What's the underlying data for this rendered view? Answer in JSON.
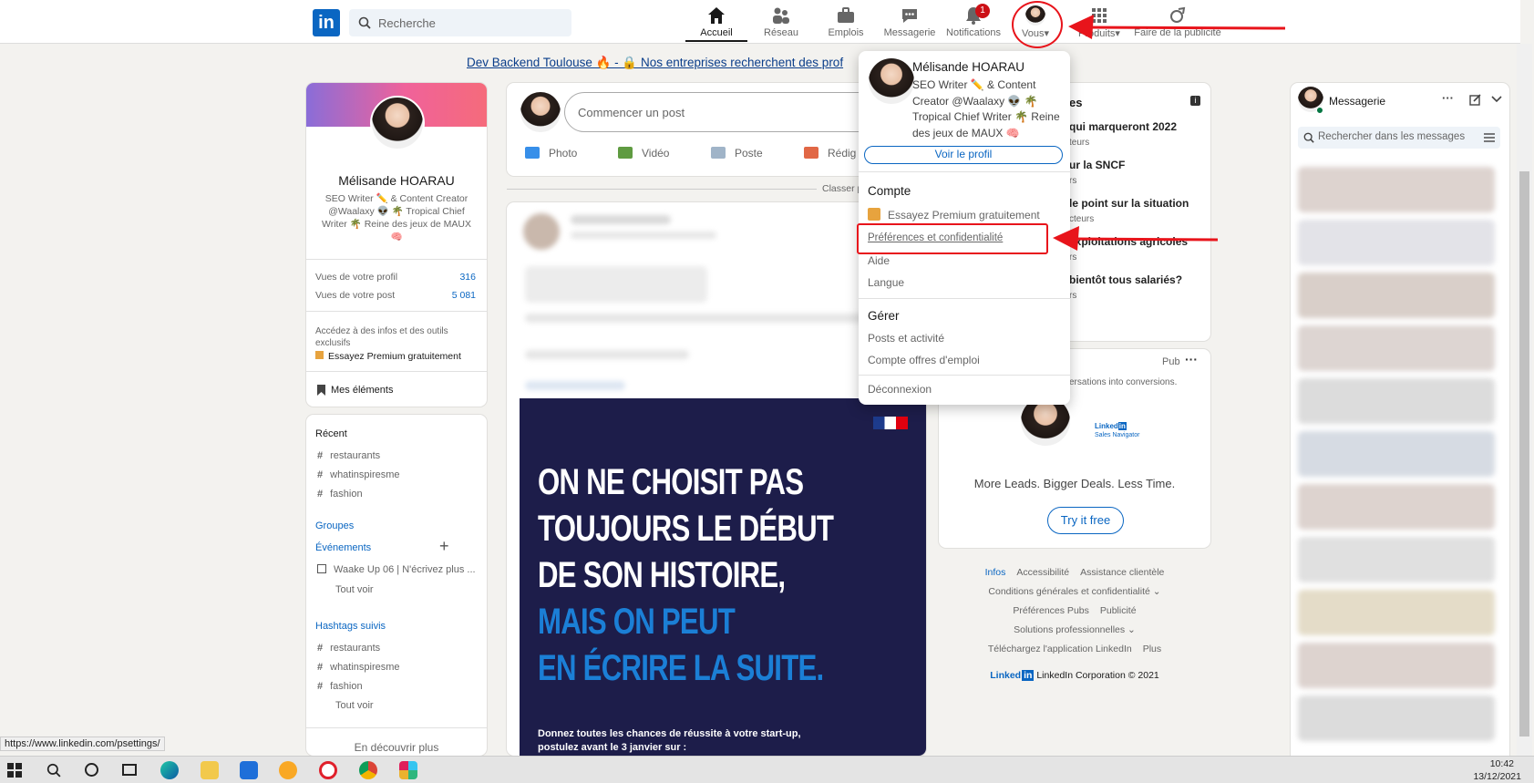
{
  "nav": {
    "search_placeholder": "Recherche",
    "items": [
      "Accueil",
      "Réseau",
      "Emplois",
      "Messagerie",
      "Notifications",
      "Vous",
      "Produits",
      "Faire de la publicité"
    ],
    "notif_count": "1",
    "vous_caret": "▾",
    "produits_caret": "▾"
  },
  "banner": {
    "text": "Dev Backend Toulouse 🔥 - 🔒 Nos entreprises recherchent des prof"
  },
  "profile": {
    "name": "Mélisande HOARAU",
    "headline": "SEO Writer ✏️ & Content Creator @Waalaxy 👽 🌴 Tropical Chief Writer 🌴 Reine des jeux de MAUX 🧠",
    "stats": [
      {
        "label": "Vues de votre profil",
        "value": "316"
      },
      {
        "label": "Vues de votre post",
        "value": "5 081"
      }
    ],
    "premium_text": "Accédez à des infos et des outils exclusifs",
    "premium_link": "Essayez Premium gratuitement",
    "my_items": "Mes éléments"
  },
  "left_nav": {
    "recent_title": "Récent",
    "recent": [
      "restaurants",
      "whatinspiresme",
      "fashion"
    ],
    "groups": "Groupes",
    "events": "Événements",
    "event_item": "Waake Up 06 | N'écrivez plus ...",
    "see_all": "Tout voir",
    "hashtags_title": "Hashtags suivis",
    "hashtags": [
      "restaurants",
      "whatinspiresme",
      "fashion"
    ],
    "see_all2": "Tout voir",
    "discover": "En découvrir plus"
  },
  "composer": {
    "placeholder": "Commencer un post",
    "actions": [
      "Photo",
      "Vidéo",
      "Poste",
      "Rédig"
    ],
    "sort": "Classer p"
  },
  "ad_image": {
    "line1": "ON NE CHOISIT PAS",
    "line2": "TOUJOURS LE DÉBUT",
    "line3": "DE SON HISTOIRE,",
    "line4": "MAIS ON PEUT",
    "line5": "EN ÉCRIRE LA SUITE.",
    "footer1": "Donnez toutes les chances de réussite à votre start-up,",
    "footer2": "postulez avant le 3 janvier sur :"
  },
  "news": {
    "items": [
      {
        "title": "es",
        "sub": ""
      },
      {
        "title": "qui marqueront 2022",
        "sub": "teurs"
      },
      {
        "title": "ur la SNCF",
        "sub": "rs"
      },
      {
        "title": "le point sur la situation",
        "sub": "cteurs"
      },
      {
        "title": "exploitations agricoles",
        "sub": "rs"
      },
      {
        "title": "bientôt tous salariés?",
        "sub": "rs"
      }
    ]
  },
  "ad": {
    "label": "Pub",
    "text": "ersations into conversions.",
    "brand": "Linked",
    "brand_in": "in",
    "brand_sub": "Sales Navigator",
    "tagline": "More Leads. Bigger Deals. Less Time.",
    "cta": "Try it free"
  },
  "footer": {
    "links1": [
      "Infos",
      "Accessibilité",
      "Assistance clientèle"
    ],
    "link2": "Conditions générales et confidentialité",
    "links3": [
      "Préférences Pubs",
      "Publicité"
    ],
    "link4": "Solutions professionnelles",
    "links5": [
      "Téléchargez l'application LinkedIn",
      "Plus"
    ],
    "copyright": "LinkedIn Corporation © 2021",
    "logo": "Linked",
    "logo_in": "in"
  },
  "dropdown": {
    "name": "Mélisande HOARAU",
    "headline": "SEO Writer ✏️ & Content Creator @Waalaxy 👽 🌴 Tropical Chief Writer 🌴 Reine des jeux de MAUX 🧠",
    "view_profile": "Voir le profil",
    "account_title": "Compte",
    "premium": "Essayez Premium gratuitement",
    "prefs": "Préférences et confidentialité",
    "help": "Aide",
    "language": "Langue",
    "manage_title": "Gérer",
    "posts": "Posts et activité",
    "jobs": "Compte offres d'emploi",
    "logout": "Déconnexion"
  },
  "messaging": {
    "title": "Messagerie",
    "search_placeholder": "Rechercher dans les messages",
    "dots": "···"
  },
  "status_url": "https://www.linkedin.com/psettings/",
  "taskbar": {
    "time": "10:42",
    "date": "13/12/2021"
  },
  "colors": {
    "accent": "#0a66c2",
    "annotation": "#e8141b",
    "ad_bg": "#1d1d4a",
    "ad_blue": "#1b7fd6"
  }
}
